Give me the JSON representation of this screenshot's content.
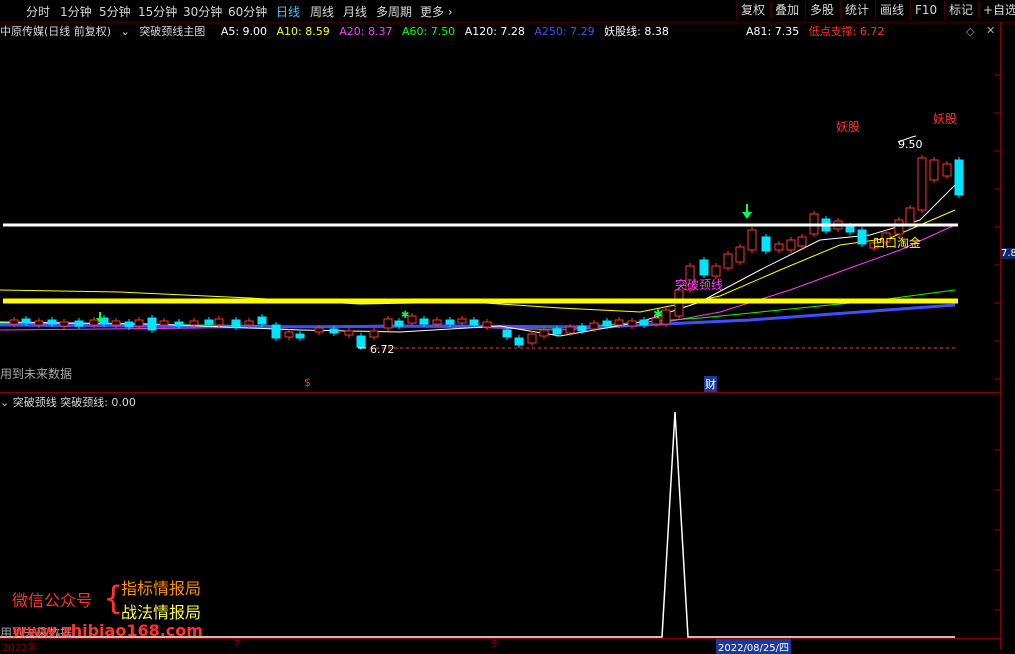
{
  "toolbar": {
    "periods": [
      "分时",
      "1分钟",
      "5分钟",
      "15分钟",
      "30分钟",
      "60分钟",
      "日线",
      "周线",
      "月线",
      "多周期",
      "更多"
    ],
    "active_period": "日线",
    "right_buttons": [
      "复权",
      "叠加",
      "多股",
      "统计",
      "画线",
      "F10",
      "标记",
      "+自选"
    ]
  },
  "info": {
    "stock": "中原传媒(日线 前复权)",
    "indicator": "突破颈线主图",
    "ma": [
      {
        "label": "A5: 9.00",
        "color": "#ffffff"
      },
      {
        "label": "A10: 8.59",
        "color": "#ffff00"
      },
      {
        "label": "A20: 8.37",
        "color": "#ff3cff"
      },
      {
        "label": "A60: 7.50",
        "color": "#00ff00"
      },
      {
        "label": "A120: 7.28",
        "color": "#ffffff"
      },
      {
        "label": "A250: 7.29",
        "color": "#3c50ff"
      },
      {
        "label": "妖股线: 8.38",
        "color": "#ffffff"
      }
    ],
    "extra": [
      {
        "label": "A81: 7.35",
        "color": "#ffffff"
      },
      {
        "label": "低点支撑: 6.72",
        "color": "#ff3030"
      }
    ]
  },
  "main": {
    "future_data": "用到未来数据",
    "annotations": {
      "yaogu1": "妖股",
      "yaogu2": "妖股",
      "high": "9.50",
      "low": "6.72",
      "tupo1": "突破颈线",
      "aotu": "凹口淘金",
      "price_tag": "7.8"
    },
    "markers": {
      "dollar": "$",
      "cai": "财"
    }
  },
  "sub": {
    "title": "突破颈线",
    "value": "突破颈线: 0.00"
  },
  "watermark": {
    "wechat": "微信公众号",
    "line1": "指标情报局",
    "line2": "战法情报局",
    "site": "www.zhibiao168.com",
    "future_data2": "用到未来数据"
  },
  "bottom": {
    "year": "2022年",
    "m7": "7",
    "m9": "9",
    "date": "2022/08/25/四"
  },
  "colors": {
    "up": "#ff3232",
    "down": "#00e5ff",
    "bg": "#000000",
    "grid": "#8a0000"
  }
}
